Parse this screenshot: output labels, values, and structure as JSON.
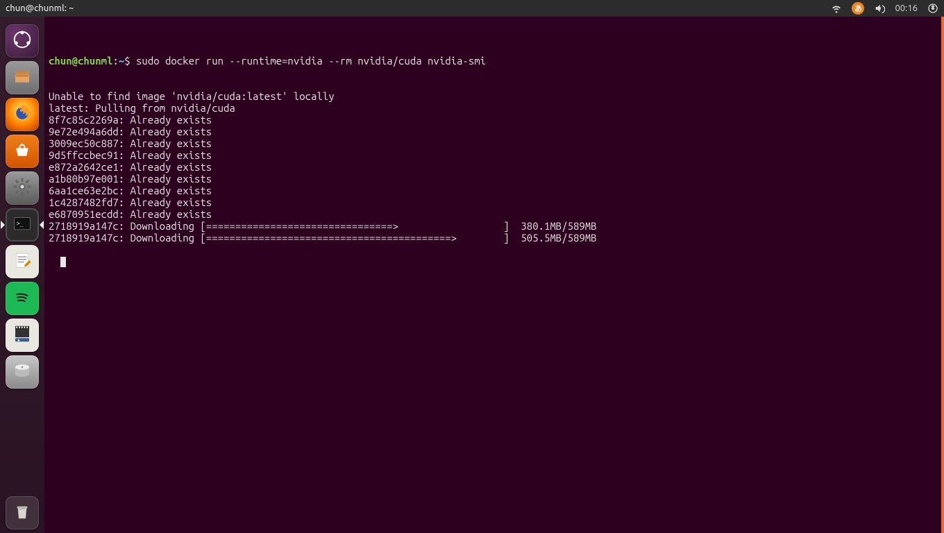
{
  "menubar": {
    "title": "chun@chunml: ~",
    "ime_char": "あ",
    "clock": "00:16"
  },
  "launcher": {
    "items": [
      {
        "name": "ubuntu-dash",
        "bg": "bg-ubuntu"
      },
      {
        "name": "files",
        "bg": "bg-files"
      },
      {
        "name": "firefox",
        "bg": "bg-firefox"
      },
      {
        "name": "ubuntu-software",
        "bg": "bg-software"
      },
      {
        "name": "system-settings",
        "bg": "bg-settings"
      },
      {
        "name": "terminal",
        "bg": "bg-terminal",
        "active": true,
        "running": true
      },
      {
        "name": "text-editor",
        "bg": "bg-gedit"
      },
      {
        "name": "spotify",
        "bg": "bg-spotify"
      },
      {
        "name": "video-player",
        "bg": "bg-video"
      },
      {
        "name": "disk-usage",
        "bg": "bg-disk"
      }
    ],
    "trash": {
      "name": "trash",
      "bg": "bg-trash"
    }
  },
  "terminal": {
    "prompt": {
      "user_host": "chun@chunml",
      "sep1": ":",
      "path": "~",
      "sep2": "$ "
    },
    "command": "sudo docker run --runtime=nvidia --rm nvidia/cuda nvidia-smi",
    "lines": [
      "Unable to find image 'nvidia/cuda:latest' locally",
      "latest: Pulling from nvidia/cuda",
      "8f7c85c2269a: Already exists ",
      "9e72e494a6dd: Already exists ",
      "3009ec50c887: Already exists ",
      "9d5ffccbec91: Already exists ",
      "e872a2642ce1: Already exists ",
      "a1b80b97e001: Already exists ",
      "6aa1ce63e2bc: Already exists ",
      "1c4287482fd7: Already exists ",
      "e6870951ecdd: Already exists ",
      "2718919a147c: Downloading [================================>                  ]  380.1MB/589MB",
      "2718919a147c: Downloading [==========================================>        ]  505.5MB/589MB"
    ]
  }
}
